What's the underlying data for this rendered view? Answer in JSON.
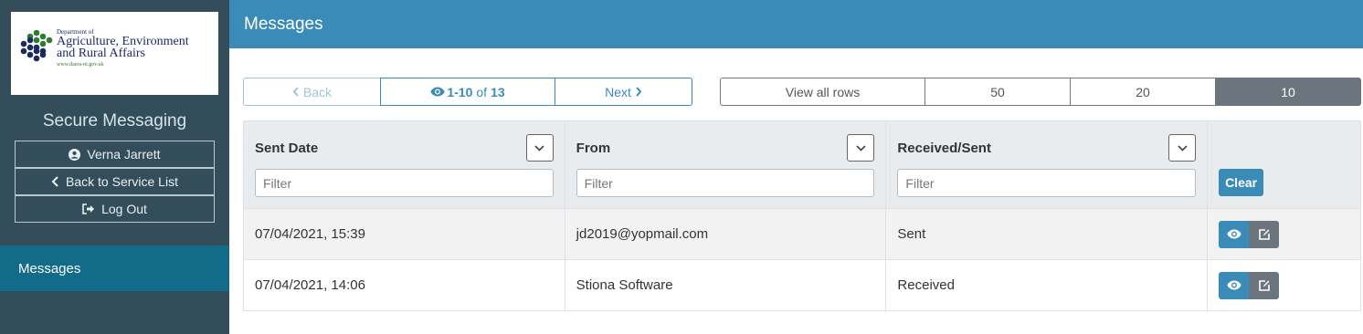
{
  "sidebar": {
    "logo": {
      "dept": "Department of",
      "line1": "Agriculture, Environment",
      "line2": "and Rural Affairs",
      "url": "www.daera-ni.gov.uk"
    },
    "app_title": "Secure Messaging",
    "user_label": "Verna Jarrett",
    "back_label": "Back to Service List",
    "logout_label": "Log Out",
    "nav": [
      {
        "label": "Messages",
        "active": true
      }
    ]
  },
  "header": {
    "title": "Messages"
  },
  "pager": {
    "prev_label": "Back",
    "range": "1-10",
    "of_label": "of",
    "total": "13",
    "next_label": "Next"
  },
  "page_size": {
    "options": [
      "View all rows",
      "50",
      "20",
      "10"
    ],
    "selected": "10"
  },
  "table": {
    "columns": [
      {
        "title": "Sent Date",
        "filter_placeholder": "Filter"
      },
      {
        "title": "From",
        "filter_placeholder": "Filter"
      },
      {
        "title": "Received/Sent",
        "filter_placeholder": "Filter"
      }
    ],
    "clear_label": "Clear",
    "rows": [
      {
        "sent_date": "07/04/2021, 15:39",
        "from": "jd2019@yopmail.com",
        "received_sent": "Sent"
      },
      {
        "sent_date": "07/04/2021, 14:06",
        "from": "Stiona Software",
        "received_sent": "Received"
      }
    ]
  },
  "colors": {
    "sidebar_bg": "#334e5a",
    "header_bg": "#3a8bb7",
    "nav_active_bg": "#136b8a",
    "accent": "#3a8bb7",
    "secondary": "#6c757d"
  }
}
